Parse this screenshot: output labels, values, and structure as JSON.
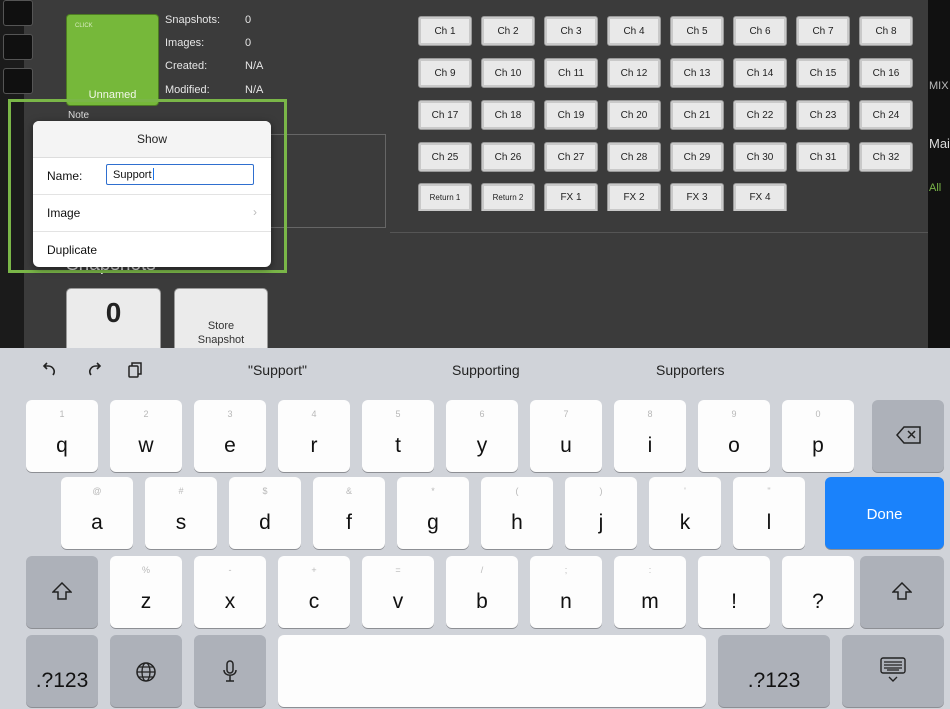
{
  "show_info": {
    "thumbnail_tag": "CLICK",
    "thumbnail_name": "Unnamed",
    "snapshots_label": "Snapshots:",
    "snapshots_value": "0",
    "images_label": "Images:",
    "images_value": "0",
    "created_label": "Created:",
    "created_value": "N/A",
    "modified_label": "Modified:",
    "modified_value": "N/A",
    "notes_label": "Note"
  },
  "channels": [
    [
      "Ch 1",
      "Ch 2",
      "Ch 3",
      "Ch 4",
      "Ch 5",
      "Ch 6",
      "Ch 7",
      "Ch 8"
    ],
    [
      "Ch 9",
      "Ch 10",
      "Ch 11",
      "Ch 12",
      "Ch 13",
      "Ch 14",
      "Ch 15",
      "Ch 16"
    ],
    [
      "Ch 17",
      "Ch 18",
      "Ch 19",
      "Ch 20",
      "Ch 21",
      "Ch 22",
      "Ch 23",
      "Ch 24"
    ],
    [
      "Ch 25",
      "Ch 26",
      "Ch 27",
      "Ch 28",
      "Ch 29",
      "Ch 30",
      "Ch 31",
      "Ch 32"
    ],
    [
      "Return 1",
      "Return 2",
      "FX 1",
      "FX 2",
      "FX 3",
      "FX 4"
    ]
  ],
  "snapshots": {
    "heading": "Snapshots",
    "count": "0",
    "store_line1": "Store",
    "store_line2": "Snapshot"
  },
  "right_strip": {
    "mix": "MIX",
    "main": "Mai",
    "all": "All"
  },
  "popup": {
    "title": "Show",
    "name_label": "Name:",
    "name_value": "Support",
    "image_label": "Image",
    "duplicate_label": "Duplicate"
  },
  "keyboard": {
    "suggestions": [
      "\"Support\"",
      "Supporting",
      "Supporters"
    ],
    "rows": [
      [
        {
          "k": "q",
          "h": "1"
        },
        {
          "k": "w",
          "h": "2"
        },
        {
          "k": "e",
          "h": "3"
        },
        {
          "k": "r",
          "h": "4"
        },
        {
          "k": "t",
          "h": "5"
        },
        {
          "k": "y",
          "h": "6"
        },
        {
          "k": "u",
          "h": "7"
        },
        {
          "k": "i",
          "h": "8"
        },
        {
          "k": "o",
          "h": "9"
        },
        {
          "k": "p",
          "h": "0"
        }
      ],
      [
        {
          "k": "a",
          "h": "@"
        },
        {
          "k": "s",
          "h": "#"
        },
        {
          "k": "d",
          "h": "$"
        },
        {
          "k": "f",
          "h": "&"
        },
        {
          "k": "g",
          "h": "*"
        },
        {
          "k": "h",
          "h": "("
        },
        {
          "k": "j",
          "h": ")"
        },
        {
          "k": "k",
          "h": "'"
        },
        {
          "k": "l",
          "h": "\""
        }
      ],
      [
        {
          "k": "z",
          "h": "%"
        },
        {
          "k": "x",
          "h": "-"
        },
        {
          "k": "c",
          "h": "+"
        },
        {
          "k": "v",
          "h": "="
        },
        {
          "k": "b",
          "h": "/"
        },
        {
          "k": "n",
          "h": ";"
        },
        {
          "k": "m",
          "h": ":"
        },
        {
          "k": "!",
          "h": ""
        },
        {
          "k": "?",
          "h": ""
        }
      ]
    ],
    "done_label": "Done",
    "numbers_label": ".?123",
    "accent_color": "#1a82fb"
  }
}
